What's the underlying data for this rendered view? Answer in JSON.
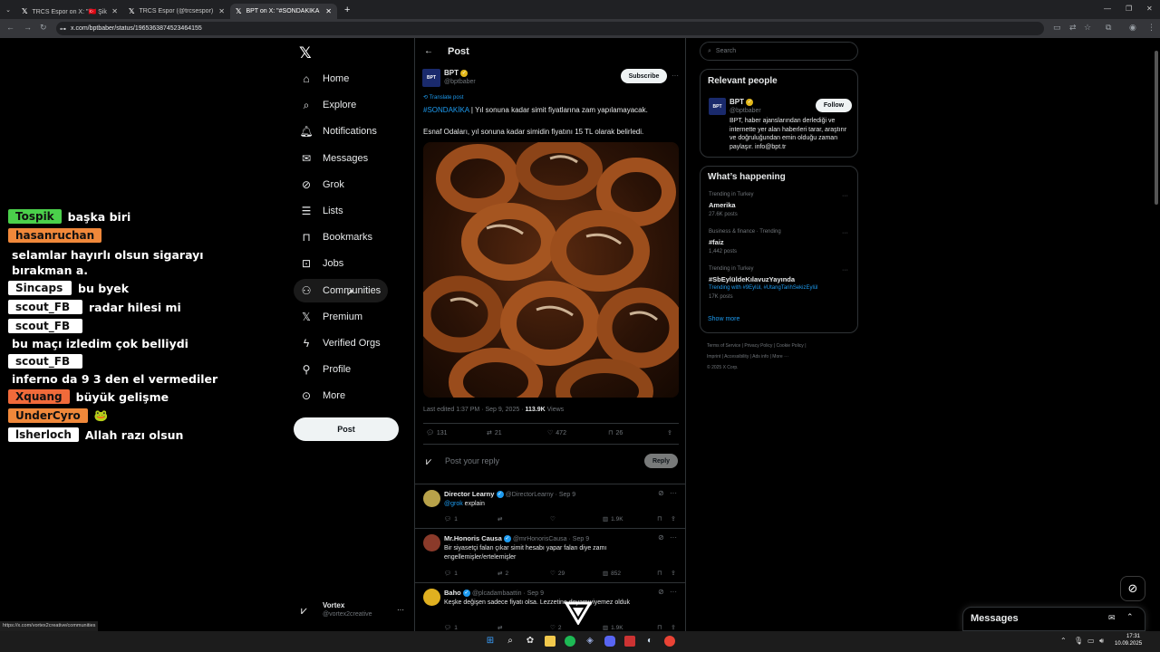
{
  "browser": {
    "tabs": [
      {
        "label": "TRCS Espor on X: \"🇹🇷 Şikeci sc",
        "icon": "x-logo-icon",
        "active": false
      },
      {
        "label": "TRCS Espor (@trcsespor) / X",
        "icon": "x-logo-icon",
        "active": false
      },
      {
        "label": "BPT on X: \"#SONDAKİKA | Yıl so",
        "icon": "x-logo-icon",
        "active": true
      }
    ],
    "new_tab": "+",
    "url": "x.com/bptbaber/status/1965363874523464155",
    "status_url": "https://x.com/vortex2creative/communities"
  },
  "chat": [
    {
      "user": "Tospik",
      "color": "green",
      "msg": "başka biri"
    },
    {
      "user": "hasanruchan",
      "color": "orange",
      "msg": "selamlar hayırlı olsun sigarayı bırakman a."
    },
    {
      "user": "Sincaps",
      "color": "white",
      "msg": "bu byek"
    },
    {
      "user": "scout_FB",
      "color": "white",
      "msg": "radar hilesi mi"
    },
    {
      "user": "scout_FB",
      "color": "white",
      "msg": "bu maçı izledim çok belliydi"
    },
    {
      "user": "scout_FB",
      "color": "white",
      "msg": "inferno da 9 3 den el vermediler"
    },
    {
      "user": "Xquang",
      "color": "red",
      "msg": "büyük gelişme"
    },
    {
      "user": "UnderCyro",
      "color": "orange",
      "msg": "🐸"
    },
    {
      "user": "lsherloch",
      "color": "white",
      "msg": "Allah razı olsun"
    }
  ],
  "nav": {
    "items": [
      {
        "label": "Home",
        "icon": "home-icon"
      },
      {
        "label": "Explore",
        "icon": "search-icon"
      },
      {
        "label": "Notifications",
        "icon": "bell-icon"
      },
      {
        "label": "Messages",
        "icon": "envelope-icon"
      },
      {
        "label": "Grok",
        "icon": "grok-icon"
      },
      {
        "label": "Lists",
        "icon": "list-icon"
      },
      {
        "label": "Bookmarks",
        "icon": "bookmark-icon"
      },
      {
        "label": "Jobs",
        "icon": "briefcase-icon"
      },
      {
        "label": "Communities",
        "icon": "people-icon"
      },
      {
        "label": "Premium",
        "icon": "x-logo-icon"
      },
      {
        "label": "Verified Orgs",
        "icon": "lightning-icon"
      },
      {
        "label": "Profile",
        "icon": "person-icon"
      },
      {
        "label": "More",
        "icon": "more-circle-icon"
      }
    ],
    "post_button": "Post",
    "account": {
      "name": "Vortex",
      "handle": "@vortex2creative",
      "more": "···"
    }
  },
  "post": {
    "header": "Post",
    "author": {
      "name": "BPT",
      "handle": "@bptbaber",
      "avatar_text": "BPT"
    },
    "subscribe": "Subscribe",
    "translate": "Translate post",
    "hashtag": "#SONDAKİKA",
    "text1": " | Yıl sonuna kadar simit fiyatlarına zam yapılamayacak.",
    "text2": "Esnaf Odaları, yıl sonuna kadar simidin fiyatını 15 TL olarak belirledi.",
    "meta": "Last edited 1:37 PM · Sep 9, 2025 · ",
    "views": "113.9K",
    "views_label": " Views",
    "stats": {
      "replies": "131",
      "reposts": "21",
      "likes": "472",
      "bookmarks": "26"
    },
    "reply_placeholder": "Post your reply",
    "reply_button": "Reply"
  },
  "replies": [
    {
      "name": "Director Learny",
      "handle": "@DirectorLearny · Sep 9",
      "mention": "@grok",
      "text": " explain",
      "replies": "1",
      "reposts": "",
      "likes": "",
      "views": "1.9K",
      "avatar_color": "#b8a24a"
    },
    {
      "name": "Mr.Honoris Causa",
      "handle": "@mrHonorisCausa · Sep 9",
      "mention": "",
      "text": "Bir siyasetçi falan çıkar simit hesabı yapar falan diye zamı engellemişler/ertelemişler",
      "replies": "1",
      "reposts": "2",
      "likes": "29",
      "views": "852",
      "avatar_color": "#8a3a2a"
    },
    {
      "name": "Baho",
      "handle": "@plcadambaattin · Sep 9",
      "mention": "",
      "text": "Keşke değişen sadece fiyatı olsa. Lezzetine doyamıyiyemez olduk",
      "replies": "1",
      "reposts": "",
      "likes": "2",
      "views": "1.9K",
      "avatar_color": "#e0b020"
    }
  ],
  "right": {
    "search_placeholder": "Search",
    "relevant_title": "Relevant people",
    "person": {
      "name": "BPT",
      "handle": "@bptbaber",
      "follow": "Follow",
      "bio": "BPT, haber ajanslarından derlediği ve internette yer alan haberleri tarar, araştırır ve doğruluğundan emin olduğu zaman paylaşır. info@bpt.tr"
    },
    "happening_title": "What’s happening",
    "trends": [
      {
        "context": "Trending in Turkey",
        "name": "Amerika",
        "extra": "",
        "posts": "27.6K posts"
      },
      {
        "context": "Business & finance · Trending",
        "name": "#faiz",
        "extra": "",
        "posts": "1,442 posts"
      },
      {
        "context": "Trending in Turkey",
        "name": "#SbEylüldeKılavuzYayında",
        "extra": "Trending with #9Eylül, #UtangTarihSekizEylül",
        "posts": "17K posts"
      }
    ],
    "show_more": "Show more",
    "footer": [
      "Terms of Service",
      "Privacy Policy",
      "Cookie Policy",
      "Imprint",
      "Accessibility",
      "Ads info",
      "More ···",
      "© 2025 X Corp."
    ]
  },
  "messages_dock": {
    "title": "Messages"
  },
  "taskbar": {
    "time": "17:31",
    "date": "10.09.2025"
  }
}
